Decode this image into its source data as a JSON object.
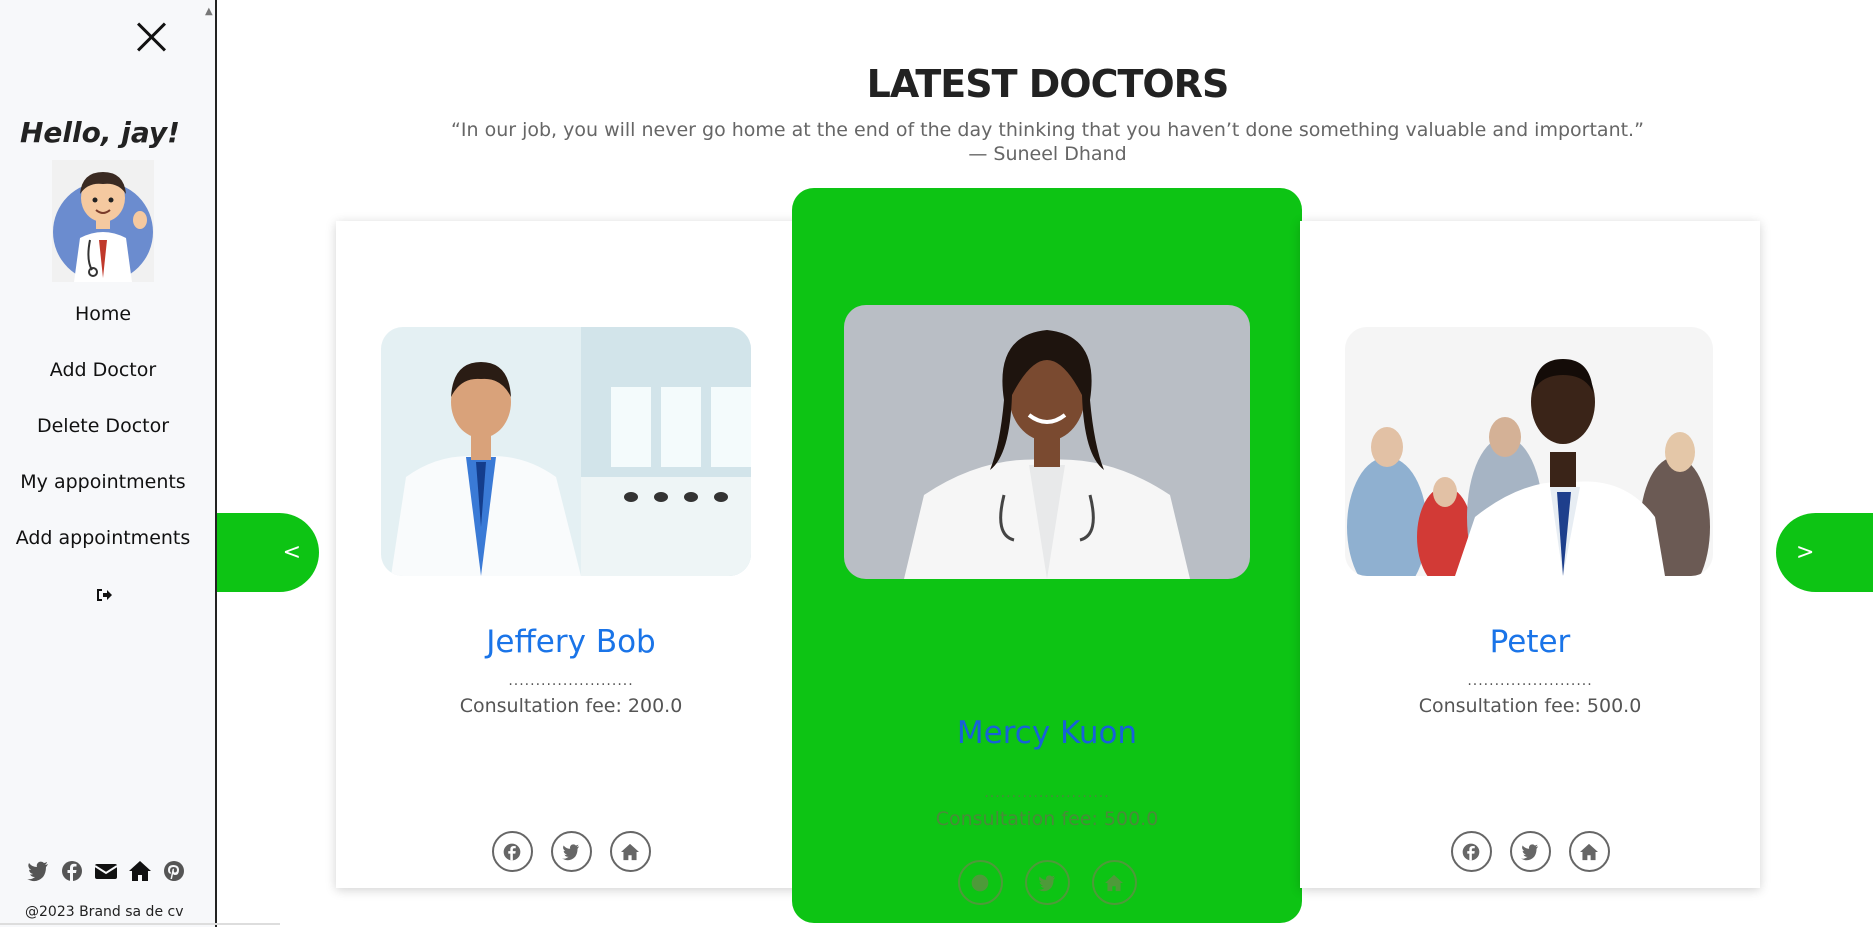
{
  "sidebar": {
    "greeting": "Hello, jay!",
    "nav": [
      "Home",
      "Add Doctor",
      "Delete Doctor",
      "My appointments",
      "Add appointments"
    ],
    "social_icons": [
      "twitter-icon",
      "facebook-icon",
      "envelope-icon",
      "home-icon",
      "pinterest-icon"
    ],
    "copyright": "@2023 Brand sa de cv"
  },
  "main": {
    "title": "LATEST DOCTORS",
    "quote": "“In our job, you will never go home at the end of the day thinking that you haven’t done something valuable and important.” — Suneel Dhand"
  },
  "carousel": {
    "prev": "<",
    "next": ">",
    "cards": [
      {
        "name": "Jeffery Bob",
        "dots": ".......................",
        "fee": "Consultation fee: 200.0"
      },
      {
        "name": "Mercy Kuon",
        "dots": ".......................",
        "fee": "Consultation fee: 500.0"
      },
      {
        "name": "Peter",
        "dots": ".......................",
        "fee": "Consultation fee: 500.0"
      }
    ]
  },
  "colors": {
    "accent": "#0dc414",
    "name_blue": "#1a74e8"
  }
}
